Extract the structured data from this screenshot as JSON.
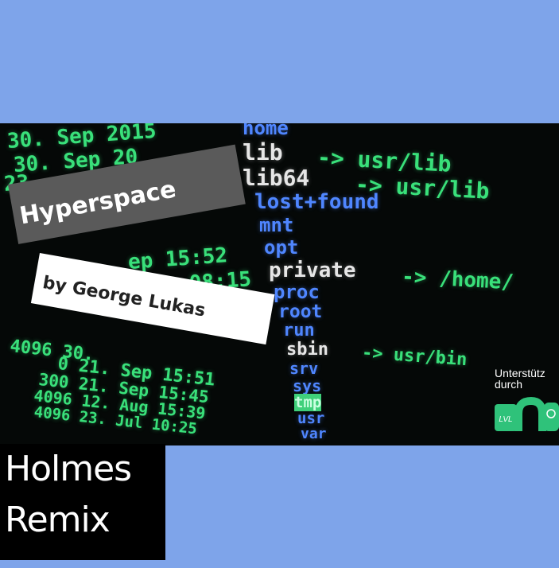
{
  "title": "Hyperspace",
  "author": "by George Lukas",
  "remix": {
    "line1": "Holmes",
    "line2": "Remix"
  },
  "support": {
    "line1": "Unterstütz",
    "line2": "durch",
    "logo_text": "LVL"
  },
  "terminal": {
    "dates": [
      "30. Sep 2015",
      "30. Sep 20",
      "23.",
      "ep 15:52",
      "ep 08:15",
      "4096 30.",
      "0 21. Sep 15:51",
      "300 21. Sep 15:45",
      "4096 12. Aug 15:39",
      "4096 23. Jul 10:25"
    ],
    "dirs": [
      "home",
      "lib",
      "lib64",
      "lost+found",
      "mnt",
      "opt",
      "private",
      "proc",
      "root",
      "run",
      "sbin",
      "srv",
      "sys",
      "tmp",
      "usr",
      "var"
    ],
    "links": [
      "-> usr/lib",
      "-> usr/lib",
      "-> /home/",
      "-> usr/bin"
    ]
  },
  "colors": {
    "background": "#7ea4ea",
    "terminal_green": "#39e07a",
    "terminal_blue": "#4f86ff",
    "logo_green": "#2fc27a"
  }
}
